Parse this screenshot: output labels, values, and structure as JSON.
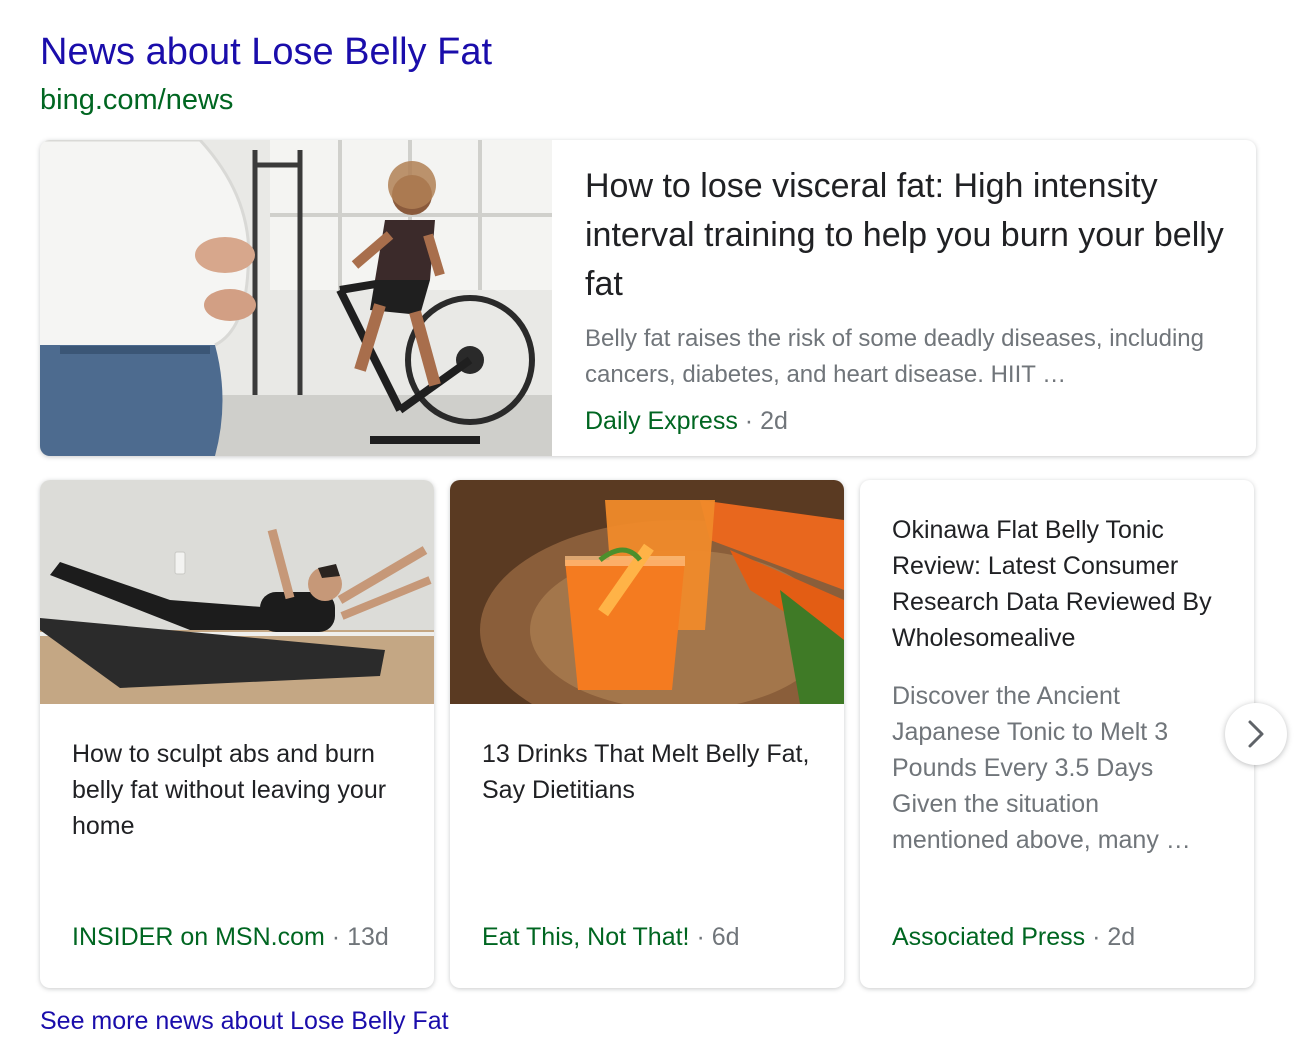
{
  "header": {
    "title": "News about Lose Belly Fat",
    "source": "bing.com/news"
  },
  "featured": {
    "title": "How to lose visceral fat: High intensity interval training to help you burn your belly fat",
    "snippet": "Belly fat raises the risk of some deadly diseases, including cancers, diabetes, and heart disease. HIIT …",
    "source": "Daily Express",
    "separator": "·",
    "age": "2d",
    "image_icon": "exercise-bike-photo"
  },
  "cards": [
    {
      "title": "How to sculpt abs and burn belly fat without leaving your home",
      "source": "INSIDER on MSN.com",
      "separator": "·",
      "age": "13d",
      "image_icon": "ab-workout-photo"
    },
    {
      "title": "13 Drinks That Melt Belly Fat, Say Dietitians",
      "source": "Eat This, Not That!",
      "separator": "·",
      "age": "6d",
      "image_icon": "carrot-juice-photo"
    },
    {
      "title": "Okinawa Flat Belly Tonic Review: Latest Consumer Research Data Reviewed By Wholesomealive",
      "snippet": "Discover the Ancient Japanese Tonic to Melt 3 Pounds Every 3.5 Days Given the situation mentioned above, many …",
      "source": "Associated Press",
      "separator": "·",
      "age": "2d"
    }
  ],
  "navigation": {
    "next_icon": "chevron-right-icon"
  },
  "footer": {
    "see_more": "See more news about Lose Belly Fat"
  },
  "colors": {
    "link": "#1a0dab",
    "source_green": "#006621",
    "muted": "#70757a",
    "title": "#202124"
  }
}
